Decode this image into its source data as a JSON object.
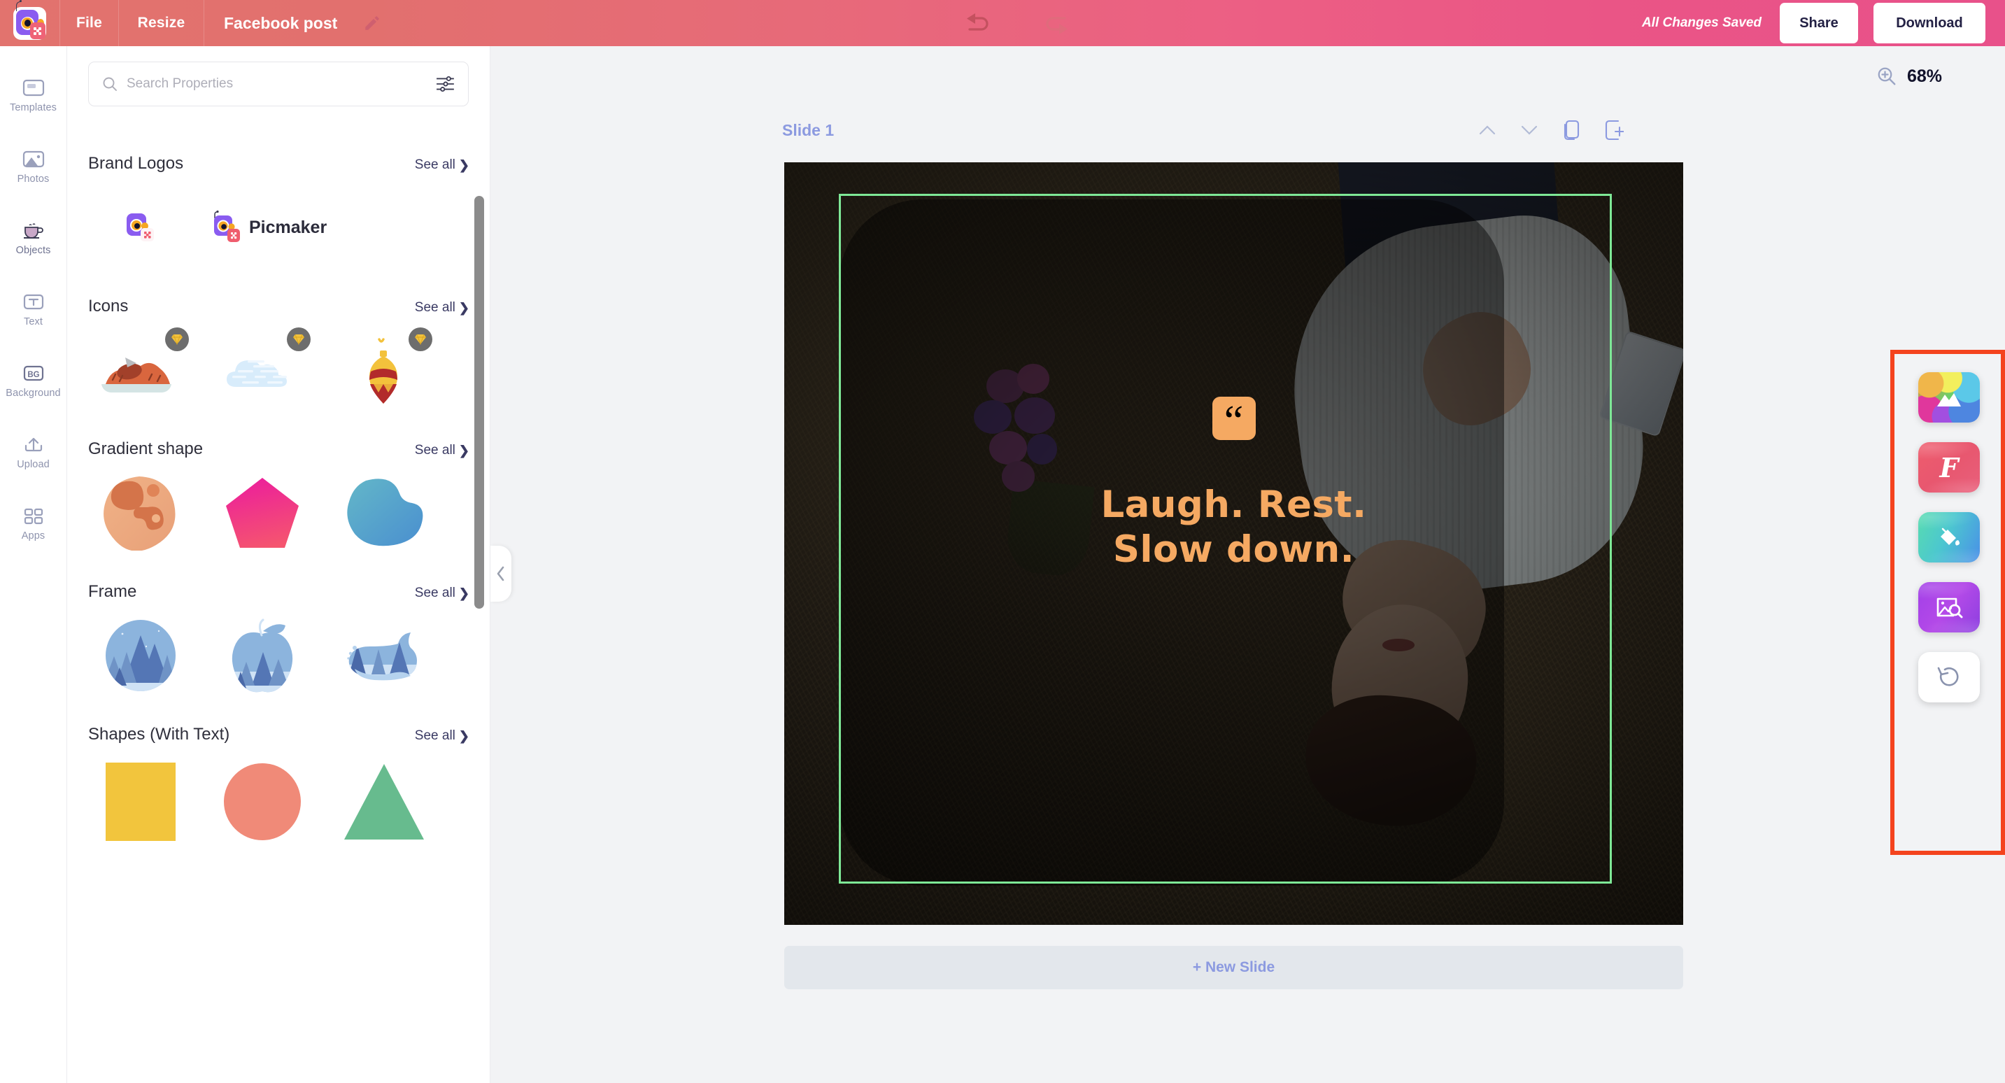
{
  "header": {
    "logo_name": "picmaker-logo",
    "menu": [
      {
        "label": "File",
        "name": "menu-file"
      },
      {
        "label": "Resize",
        "name": "menu-resize"
      }
    ],
    "document_title": "Facebook post",
    "edit_title_icon": "pencil-icon",
    "undo_icon": "undo-arrow-icon",
    "redo_icon": "redo-arrow-icon",
    "save_status": "All Changes Saved",
    "share_label": "Share",
    "download_label": "Download",
    "bg_gradient_from": "#e2736e",
    "bg_gradient_to": "#e8518a"
  },
  "rail": {
    "items": [
      {
        "label": "Templates",
        "icon": "templates-icon",
        "active": false
      },
      {
        "label": "Photos",
        "icon": "photos-icon",
        "active": false
      },
      {
        "label": "Objects",
        "icon": "objects-cup-icon",
        "active": true
      },
      {
        "label": "Text",
        "icon": "text-t-icon",
        "active": false
      },
      {
        "label": "Background",
        "icon": "background-bg-icon",
        "active": false
      },
      {
        "label": "Upload",
        "icon": "upload-arrow-icon",
        "active": false
      },
      {
        "label": "Apps",
        "icon": "apps-grid-icon",
        "active": false
      }
    ]
  },
  "panel": {
    "search": {
      "placeholder": "Search Properties",
      "value": "",
      "search_icon": "search-icon",
      "filter_icon": "filter-sliders-icon"
    },
    "see_all_label": "See all",
    "sections": [
      {
        "title": "Brand Logos",
        "name": "section-brand-logos",
        "items": [
          {
            "name": "brand-logo-mark",
            "kind": "picmaker-mark",
            "premium": false
          },
          {
            "name": "brand-logo-wordmark",
            "kind": "picmaker-wordmark",
            "premium": false,
            "label": "Picmaker"
          }
        ]
      },
      {
        "title": "Icons",
        "name": "section-icons",
        "items": [
          {
            "name": "icon-bbq-platter",
            "kind": "bbq",
            "premium": true
          },
          {
            "name": "icon-clouds",
            "kind": "clouds",
            "premium": true
          },
          {
            "name": "icon-christmas-bauble",
            "kind": "ornament",
            "premium": true
          }
        ]
      },
      {
        "title": "Gradient shape",
        "name": "section-gradient-shape",
        "items": [
          {
            "name": "gradient-blob-orange",
            "kind": "blob-orange",
            "premium": false
          },
          {
            "name": "gradient-pentagon-pink",
            "kind": "pentagon-pink",
            "premium": false
          },
          {
            "name": "gradient-blob-blue",
            "kind": "blob-blue",
            "premium": false
          }
        ]
      },
      {
        "title": "Frame",
        "name": "section-frame",
        "items": [
          {
            "name": "frame-circle-forest",
            "kind": "frame-circle",
            "premium": false
          },
          {
            "name": "frame-apple-forest",
            "kind": "frame-apple",
            "premium": false
          },
          {
            "name": "frame-whale-forest",
            "kind": "frame-whale",
            "premium": false
          }
        ]
      },
      {
        "title": "Shapes (With Text)",
        "name": "section-shapes-with-text",
        "items": [
          {
            "name": "shape-square-yellow",
            "kind": "square-yellow",
            "premium": false
          },
          {
            "name": "shape-circle-salmon",
            "kind": "circle-salmon",
            "premium": false
          },
          {
            "name": "shape-triangle-green",
            "kind": "triangle-green",
            "premium": false
          }
        ]
      }
    ],
    "collapse_icon": "chevron-left-icon",
    "scrollbar": "panel-scrollbar"
  },
  "workspace": {
    "zoom": {
      "label": "68%",
      "icon": "zoom-in-magnifier-icon"
    },
    "slide": {
      "label": "Slide 1",
      "tools": [
        {
          "name": "move-slide-up-button",
          "icon": "chevron-up-icon"
        },
        {
          "name": "move-slide-down-button",
          "icon": "chevron-down-icon"
        },
        {
          "name": "duplicate-slide-button",
          "icon": "duplicate-icon"
        },
        {
          "name": "add-slide-button",
          "icon": "add-slide-icon"
        }
      ]
    },
    "canvas": {
      "quote_icon": "quote-mark-icon",
      "quote_glyph": "“",
      "quote_line_1": "Laugh. Rest.",
      "quote_line_2": "Slow down.",
      "text_color": "#f5a962",
      "selection_color": "#7ee896",
      "photo_description": "woman lying on grass with flowers"
    },
    "new_slide_label": "+ New Slide"
  },
  "right_toolbar": {
    "highlight_color": "#f4431e",
    "buttons": [
      {
        "name": "image-effects-button",
        "icon": "rainbow-image-icon"
      },
      {
        "name": "font-style-button",
        "icon": "font-f-icon",
        "glyph": "F"
      },
      {
        "name": "fill-color-button",
        "icon": "paint-bucket-icon"
      },
      {
        "name": "replace-image-button",
        "icon": "image-search-icon"
      },
      {
        "name": "reset-history-button",
        "icon": "restore-counterclockwise-icon"
      }
    ]
  }
}
